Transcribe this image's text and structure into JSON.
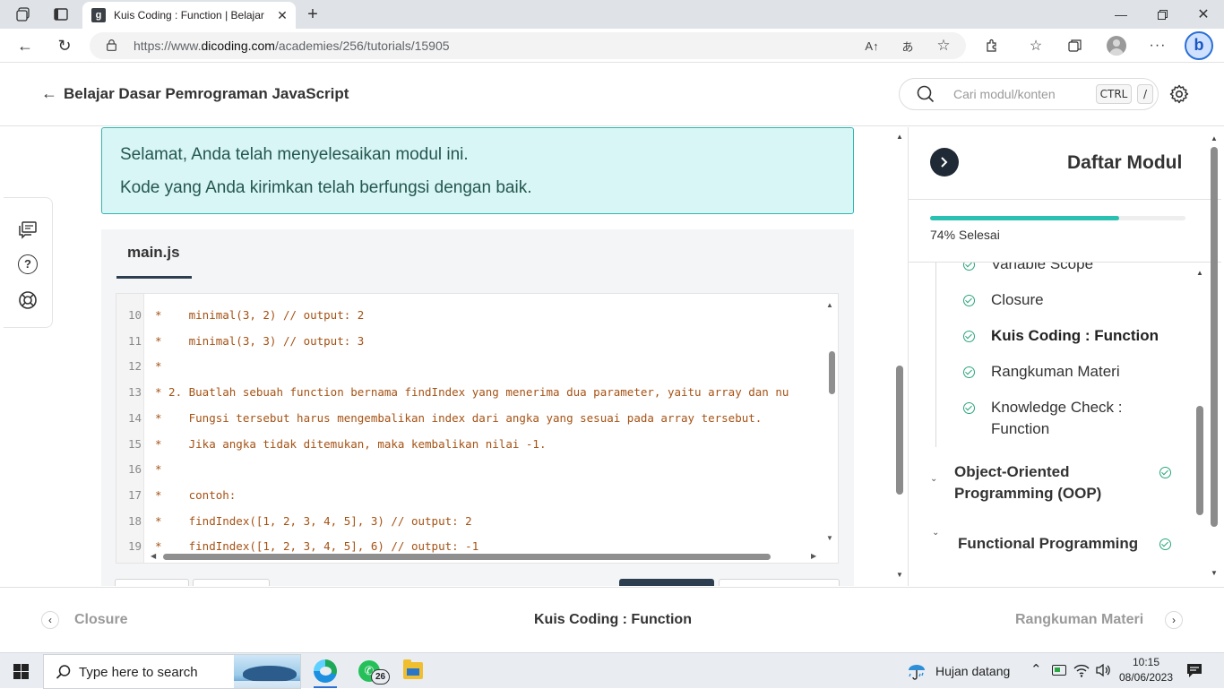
{
  "browser": {
    "tab_title": "Kuis Coding : Function | Belajar D",
    "url_prefix": "https://www.",
    "url_domain": "dicoding.com",
    "url_path": "/academies/256/tutorials/15905",
    "read_aloud_glyph": "A↑",
    "translate_glyph": "あ"
  },
  "header": {
    "course_title": "Belajar Dasar Pemrograman JavaScript",
    "search_placeholder": "Cari modul/konten",
    "kbd_ctrl": "CTRL",
    "kbd_slash": "/"
  },
  "banner": {
    "line1": "Selamat, Anda telah menyelesaikan modul ini.",
    "line2": "Kode yang Anda kirimkan telah berfungsi dengan baik."
  },
  "editor": {
    "file_tab": "main.js",
    "lines": [
      {
        "n": "10",
        "t": "*    minimal(3, 2) // output: 2"
      },
      {
        "n": "11",
        "t": "*    minimal(3, 3) // output: 3"
      },
      {
        "n": "12",
        "t": "*"
      },
      {
        "n": "13",
        "t": "* 2. Buatlah sebuah function bernama findIndex yang menerima dua parameter, yaitu array dan nu"
      },
      {
        "n": "14",
        "t": "*    Fungsi tersebut harus mengembalikan index dari angka yang sesuai pada array tersebut."
      },
      {
        "n": "15",
        "t": "*    Jika angka tidak ditemukan, maka kembalikan nilai -1."
      },
      {
        "n": "16",
        "t": "*"
      },
      {
        "n": "17",
        "t": "*    contoh:"
      },
      {
        "n": "18",
        "t": "*    findIndex([1, 2, 3, 4, 5], 3) // output: 2"
      },
      {
        "n": "19",
        "t": "*    findIndex([1, 2, 3, 4, 5], 6) // output: -1"
      }
    ]
  },
  "modules": {
    "title": "Daftar Modul",
    "progress": 0.74,
    "progress_label": "74% Selesai",
    "items": [
      {
        "label": "Variable Scope"
      },
      {
        "label": "Closure"
      },
      {
        "label": "Kuis Coding : Function"
      },
      {
        "label": "Rangkuman Materi"
      },
      {
        "label": "Knowledge Check :"
      },
      {
        "label": "Function"
      }
    ],
    "sections": [
      {
        "label": "Object-Oriented"
      },
      {
        "label": "Programming (OOP)"
      },
      {
        "label": "Functional Programming"
      }
    ]
  },
  "bottom_nav": {
    "prev": "Closure",
    "current": "Kuis Coding : Function",
    "next": "Rangkuman Materi"
  },
  "taskbar": {
    "search_placeholder": "Type here to search",
    "whatsapp_badge": "26",
    "weather": "Hujan datang",
    "time": "10:15",
    "date": "08/06/2023"
  },
  "colors": {
    "accent_teal": "#35b5b1",
    "progress": "#2bc1b2",
    "check": "#2aa57d",
    "code_text": "#a55214"
  }
}
